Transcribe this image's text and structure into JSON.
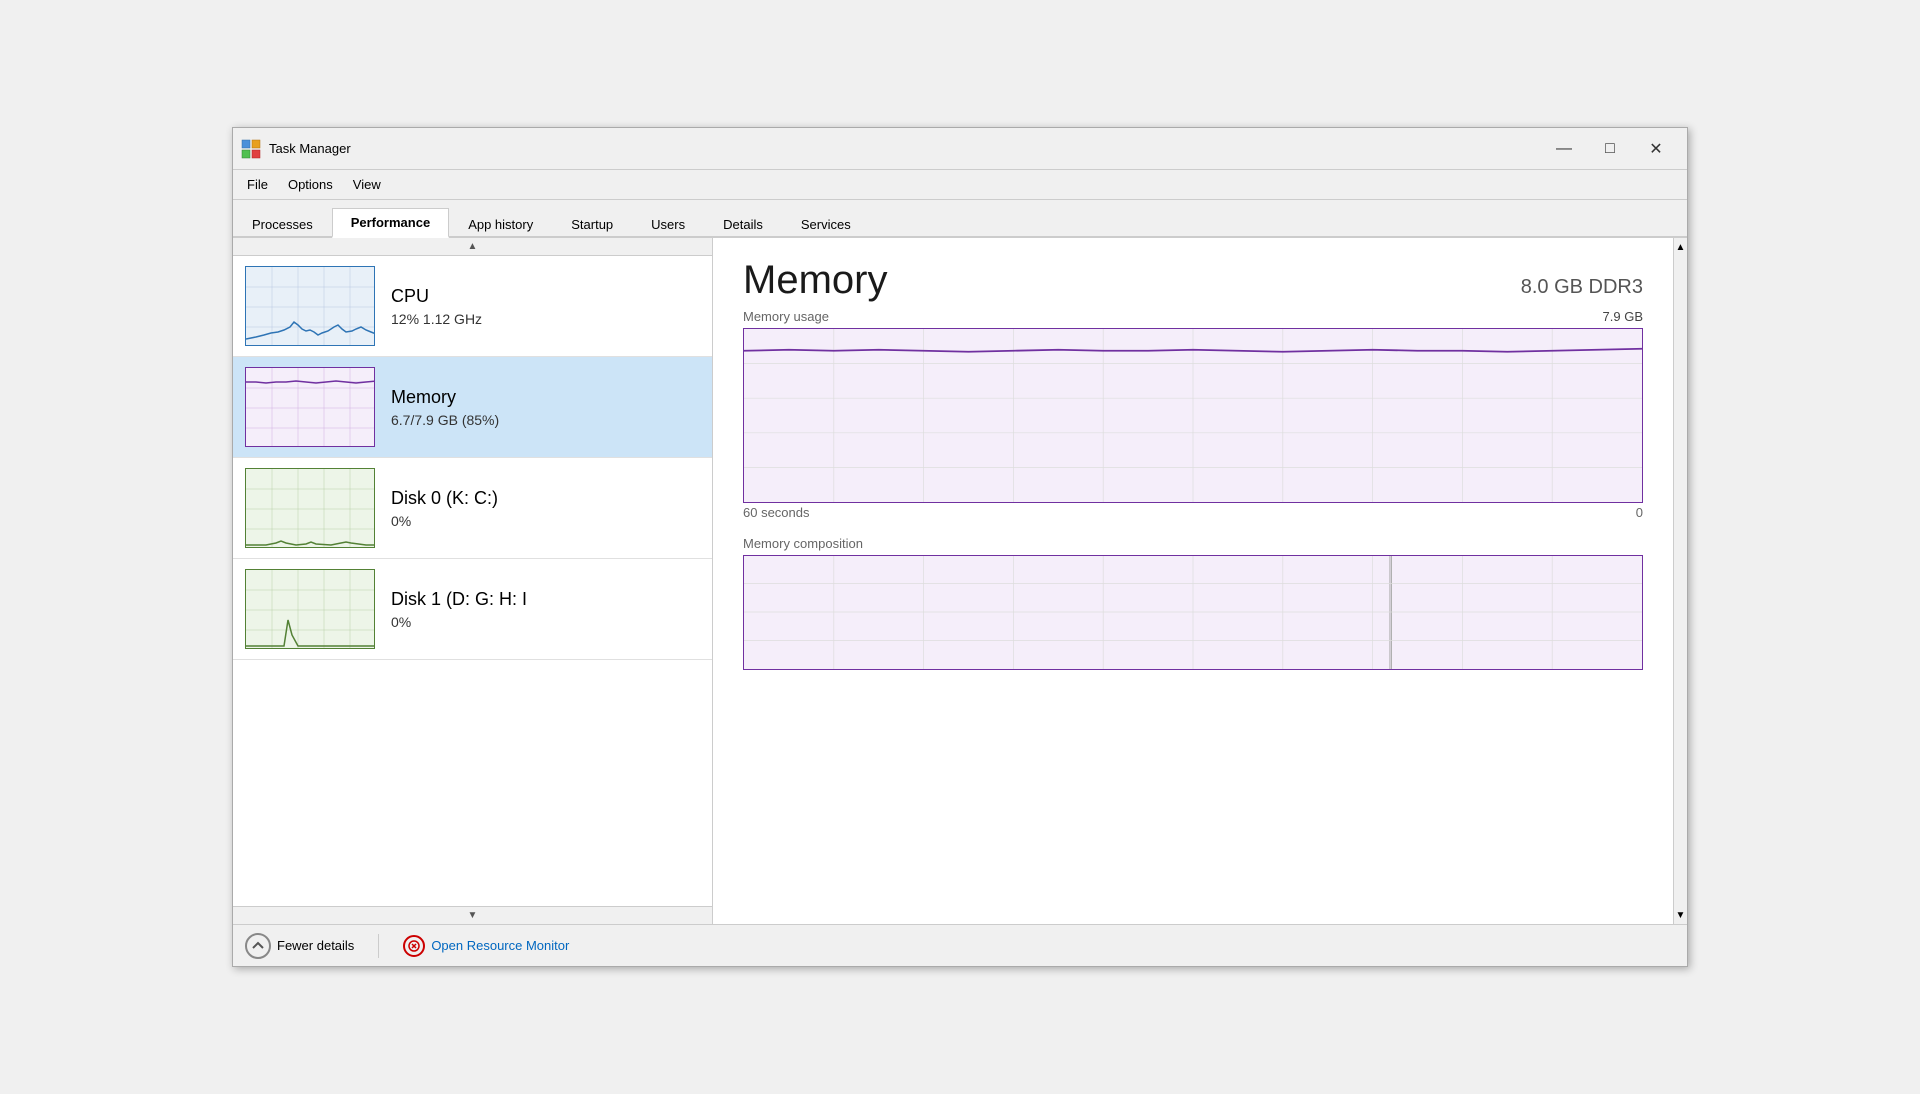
{
  "window": {
    "title": "Task Manager",
    "icon": "⊞"
  },
  "titlebar_controls": {
    "minimize": "—",
    "maximize": "□",
    "close": "✕"
  },
  "menubar": {
    "items": [
      "File",
      "Options",
      "View"
    ]
  },
  "tabs": {
    "items": [
      "Processes",
      "Performance",
      "App history",
      "Startup",
      "Users",
      "Details",
      "Services"
    ],
    "active": "Performance"
  },
  "sidebar": {
    "items": [
      {
        "id": "cpu",
        "name": "CPU",
        "sub": "12%  1.12 GHz",
        "chart_type": "blue",
        "selected": false
      },
      {
        "id": "memory",
        "name": "Memory",
        "sub": "6.7/7.9 GB (85%)",
        "chart_type": "purple",
        "selected": true
      },
      {
        "id": "disk0",
        "name": "Disk 0 (K: C:)",
        "sub": "0%",
        "chart_type": "green",
        "selected": false
      },
      {
        "id": "disk1",
        "name": "Disk 1 (D: G: H: I",
        "sub": "0%",
        "chart_type": "green",
        "selected": false
      }
    ]
  },
  "main_panel": {
    "title": "Memory",
    "subtitle": "8.0 GB DDR3",
    "usage_label": "Memory usage",
    "usage_value": "7.9 GB",
    "time_start": "60 seconds",
    "time_end": "0",
    "composition_label": "Memory composition"
  },
  "footer": {
    "fewer_details_label": "Fewer details",
    "resource_monitor_label": "Open Resource Monitor"
  }
}
